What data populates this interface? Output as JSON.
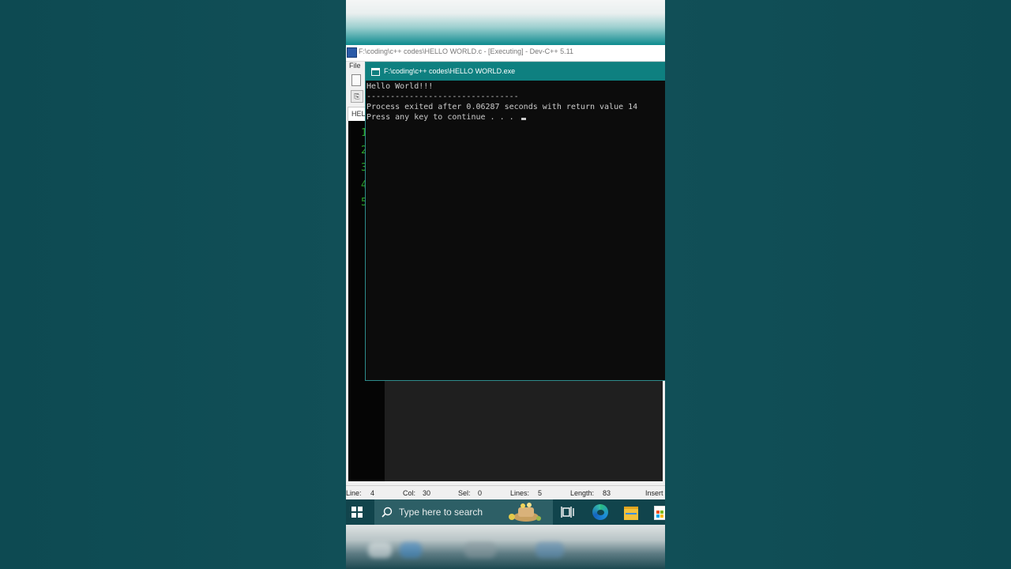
{
  "devcpp": {
    "title": "F:\\coding\\c++ codes\\HELLO WORLD.c - [Executing] - Dev-C++ 5.11",
    "menu_file": "File",
    "tab_label": "HELLO WORLD.c",
    "line_numbers": [
      "1",
      "2",
      "3",
      "4",
      "5"
    ],
    "status": {
      "line_label": "Line:",
      "line_value": "4",
      "col_label": "Col:",
      "col_value": "30",
      "sel_label": "Sel:",
      "sel_value": "0",
      "lines_label": "Lines:",
      "lines_value": "5",
      "length_label": "Length:",
      "length_value": "83",
      "mode": "Insert"
    }
  },
  "console": {
    "title": "F:\\coding\\c++ codes\\HELLO WORLD.exe",
    "lines": [
      "Hello World!!!",
      "--------------------------------",
      "Process exited after 0.06287 seconds with return value 14",
      "Press any key to continue . . . "
    ]
  },
  "taskbar": {
    "search_placeholder": "Type here to search",
    "icons": [
      "windows-start-icon",
      "search-icon",
      "task-view-icon",
      "edge-icon",
      "file-explorer-icon",
      "store-icon"
    ]
  },
  "colors": {
    "console_title_bg": "#0e8080",
    "console_bg": "#0c0c0c",
    "console_text": "#cccccc",
    "taskbar_bg": "#11444c",
    "line_number": "#2aa52a"
  }
}
